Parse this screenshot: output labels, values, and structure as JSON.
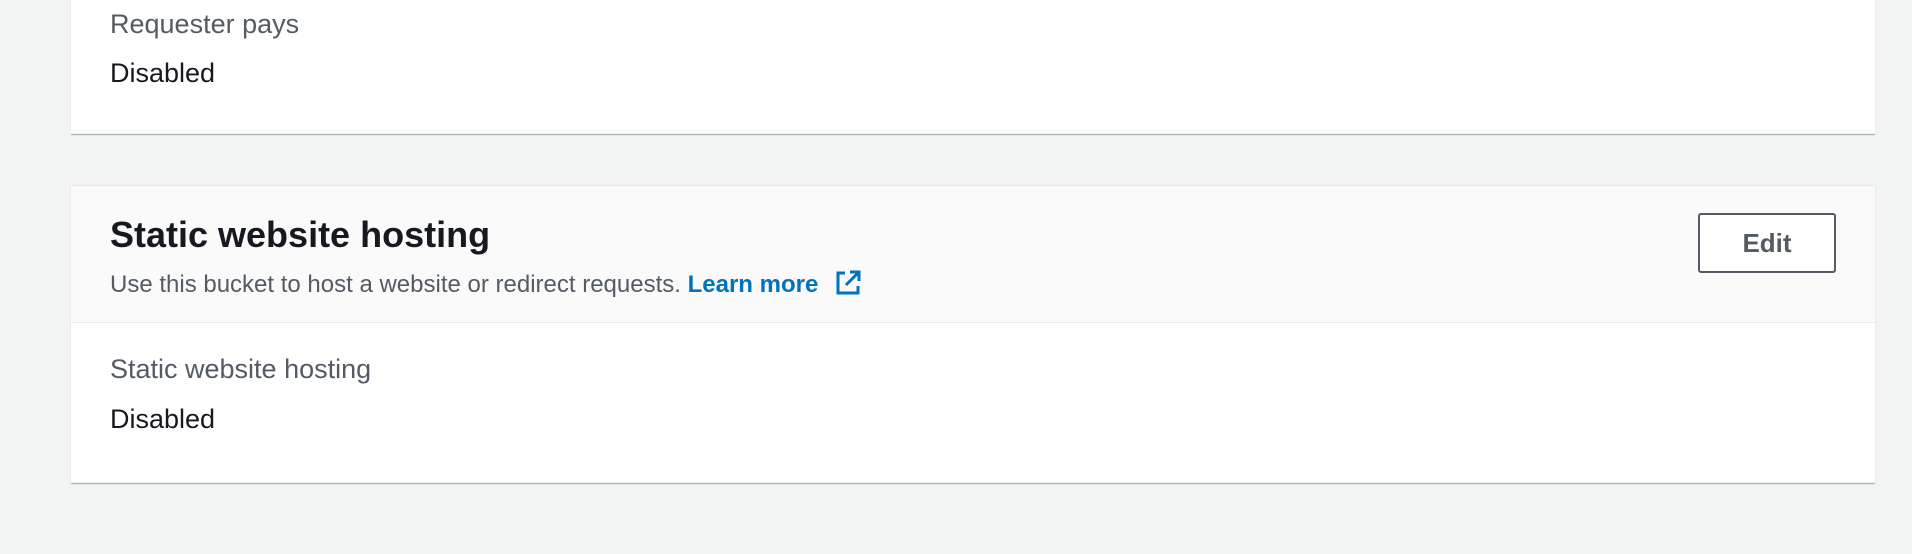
{
  "requester_pays": {
    "label": "Requester pays",
    "value": "Disabled"
  },
  "static_website_hosting": {
    "title": "Static website hosting",
    "description": "Use this bucket to host a website or redirect requests.",
    "learn_more_label": "Learn more",
    "edit_label": "Edit",
    "field_label": "Static website hosting",
    "field_value": "Disabled",
    "link_color": "#0073bb",
    "icons": {
      "learn_more": "external-link-icon"
    }
  }
}
